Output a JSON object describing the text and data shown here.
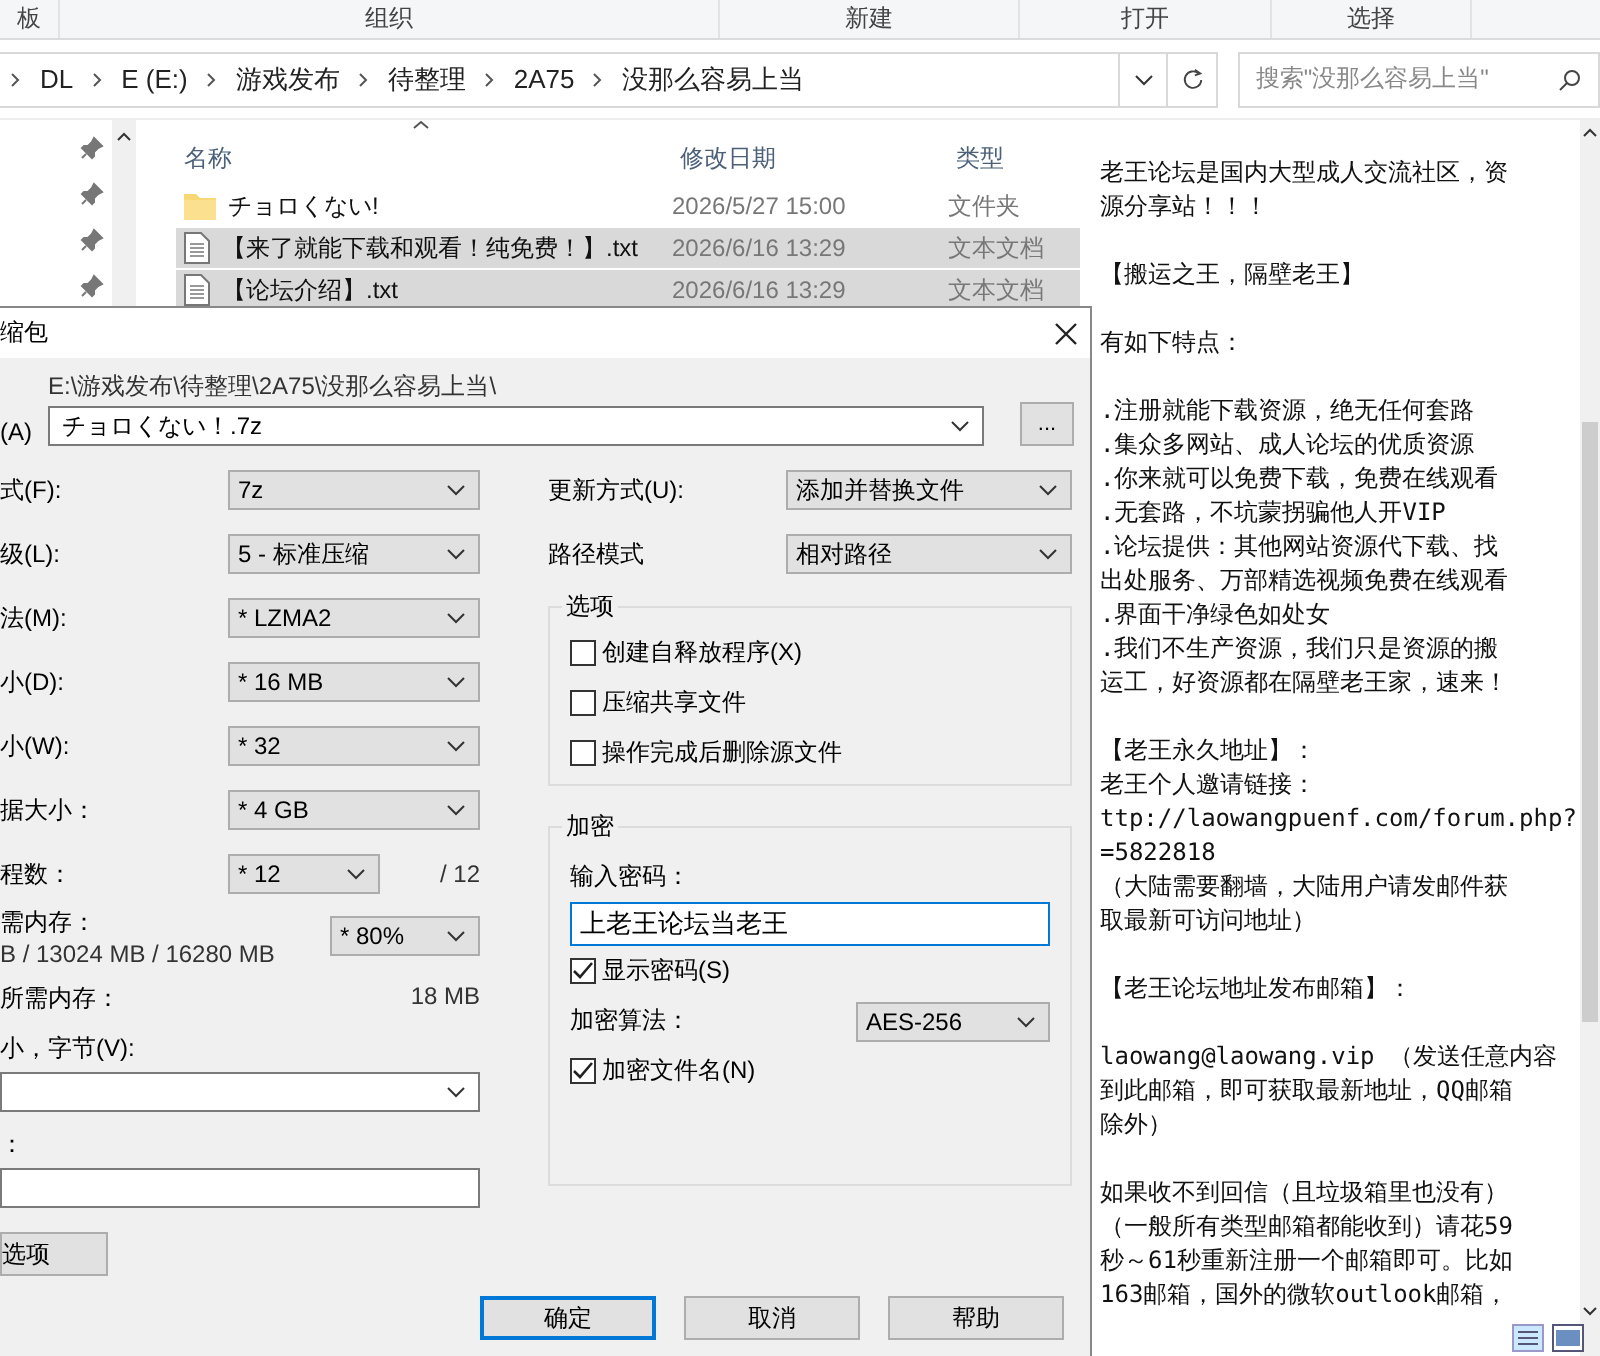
{
  "ribbon": {
    "groups": [
      "板",
      "组织",
      "新建",
      "打开",
      "选择"
    ]
  },
  "address": {
    "crumbs": [
      "DL",
      "E (E:)",
      "游戏发布",
      "待整理",
      "2A75",
      "没那么容易上当"
    ]
  },
  "search": {
    "placeholder": "搜索\"没那么容易上当\""
  },
  "file_list": {
    "columns": [
      "名称",
      "修改日期",
      "类型"
    ],
    "rows": [
      {
        "kind": "folder",
        "name": "チョロくない!",
        "date": "2026/5/27 15:00",
        "type": "文件夹",
        "selected": false
      },
      {
        "kind": "text",
        "name": "【来了就能下载和观看！纯免费！】.txt",
        "date": "2026/6/16 13:29",
        "type": "文本文档",
        "selected": true
      },
      {
        "kind": "text",
        "name": "【论坛介绍】.txt",
        "date": "2026/6/16 13:29",
        "type": "文本文档",
        "selected": true
      }
    ]
  },
  "preview": {
    "paragraphs": [
      {
        "lines": [
          "老王论坛是国内大型成人交流社区，资",
          "源分享站！！！"
        ]
      },
      {
        "lines": [
          "【搬运之王，隔壁老王】"
        ]
      },
      {
        "lines": [
          "有如下特点："
        ]
      },
      {
        "lines": [
          ".注册就能下载资源，绝无任何套路",
          ".集众多网站、成人论坛的优质资源",
          ".你来就可以免费下载，免费在线观看",
          ".无套路，不坑蒙拐骗他人开VIP",
          ".论坛提供：其他网站资源代下载、找",
          "出处服务、万部精选视频免费在线观看",
          ".界面干净绿色如处女",
          ".我们不生产资源，我们只是资源的搬",
          "运工，好资源都在隔壁老王家，速来！"
        ]
      },
      {
        "lines": [
          "【老王永久地址】：",
          "老王个人邀请链接：",
          "ttp://laowangpuenf.com/forum.php?",
          "=5822818",
          "（大陆需要翻墙，大陆用户请发邮件获",
          "取最新可访问地址）"
        ]
      },
      {
        "lines": [
          "【老王论坛地址发布邮箱】："
        ]
      },
      {
        "lines": [
          "laowang@laowang.vip  （发送任意内容",
          "到此邮箱，即可获取最新地址，QQ邮箱",
          "除外）"
        ]
      },
      {
        "lines": [
          "如果收不到回信（且垃圾箱里也没有）",
          "（一般所有类型邮箱都能收到）请花59",
          "秒～61秒重新注册一个邮箱即可。比如",
          "163邮箱，国外的微软outlook邮箱，"
        ]
      }
    ]
  },
  "dialog": {
    "title": "缩包",
    "archive": {
      "label": "(A)",
      "path": "E:\\游戏发布\\待整理\\2A75\\没那么容易上当\\",
      "value": "チョロくない！.7z",
      "browse": "..."
    },
    "left_fields": [
      {
        "kind": "select",
        "label": "式(F):",
        "value": "7z"
      },
      {
        "kind": "select",
        "label": "级(L):",
        "value": "5 - 标准压缩"
      },
      {
        "kind": "select",
        "label": "法(M):",
        "value": "* LZMA2"
      },
      {
        "kind": "select",
        "label": "小(D):",
        "value": "* 16 MB"
      },
      {
        "kind": "select",
        "label": "小(W):",
        "value": "* 32"
      },
      {
        "kind": "select",
        "label": "据大小：",
        "value": "* 4 GB"
      },
      {
        "kind": "count",
        "label": "程数：",
        "value": "* 12",
        "suffix": "/ 12"
      }
    ],
    "memory": {
      "label": "需内存：",
      "detail": "B / 13024 MB / 16280 MB",
      "value": "* 80%"
    },
    "required": {
      "label": "所需内存：",
      "value": "18 MB"
    },
    "volume": {
      "label": "小，字节(V):"
    },
    "params": {
      "label": "："
    },
    "options_button": "选项",
    "update": {
      "label": "更新方式(U):",
      "value": "添加并替换文件"
    },
    "path_mode": {
      "label": "路径模式",
      "value": "相对路径"
    },
    "options": {
      "title": "选项",
      "items": [
        {
          "label": "创建自释放程序(X)",
          "checked": false
        },
        {
          "label": "压缩共享文件",
          "checked": false
        },
        {
          "label": "操作完成后删除源文件",
          "checked": false
        }
      ]
    },
    "encryption": {
      "title": "加密",
      "password_label": "输入密码：",
      "password": "上老王论坛当老王",
      "show_password": {
        "label": "显示密码(S)",
        "checked": true
      },
      "method_label": "加密算法：",
      "method": "AES-256",
      "encrypt_names": {
        "label": "加密文件名(N)",
        "checked": true
      }
    },
    "buttons": [
      {
        "label": "确定",
        "default": true
      },
      {
        "label": "取消",
        "default": false
      },
      {
        "label": "帮助",
        "default": false
      }
    ]
  }
}
